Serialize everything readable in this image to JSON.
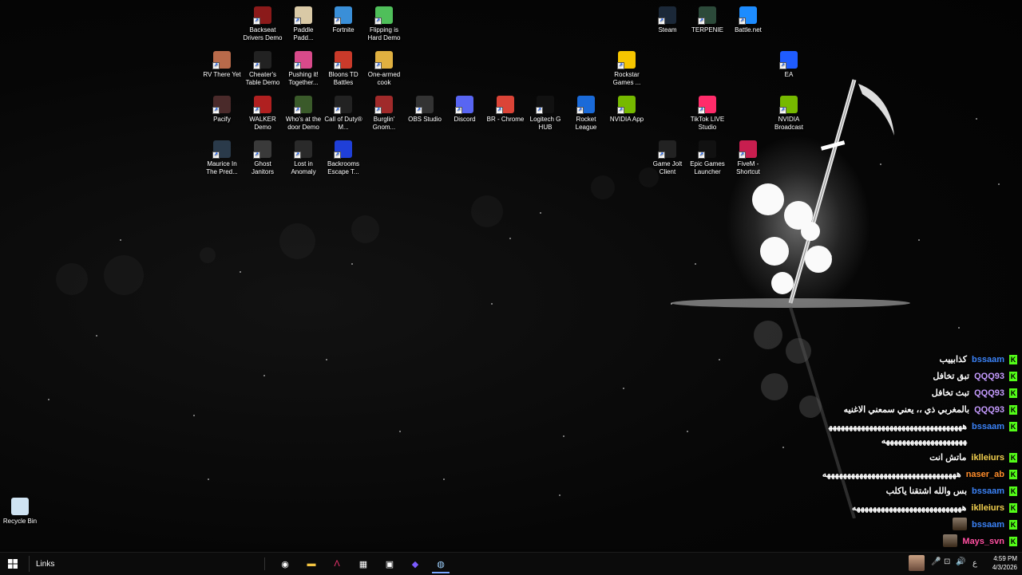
{
  "desktop": {
    "icons": [
      {
        "label": "Backseat Drivers Demo",
        "icon": "car-icon",
        "color": "#8b1a1a"
      },
      {
        "label": "Paddle Padd...",
        "icon": "face-icon",
        "color": "#d9c9a6"
      },
      {
        "label": "Fortnite",
        "icon": "fortnite-icon",
        "color": "#3a8fd8"
      },
      {
        "label": "Flipping is Hard Demo",
        "icon": "flip-icon",
        "color": "#4fbf5a"
      },
      {
        "label": "Steam",
        "icon": "steam-icon",
        "color": "#1b2838"
      },
      {
        "label": "TERPENIE",
        "icon": "terpenie-icon",
        "color": "#2c4a3a"
      },
      {
        "label": "Battle.net",
        "icon": "battlenet-icon",
        "color": "#1d8cff"
      },
      {
        "label": "RV There Yet",
        "icon": "rv-icon",
        "color": "#b86a4a"
      },
      {
        "label": "Cheater's Table Demo",
        "icon": "ct-icon",
        "color": "#222"
      },
      {
        "label": "Pushing it! Together...",
        "icon": "pushing-icon",
        "color": "#d84a8a"
      },
      {
        "label": "Bloons TD Battles",
        "icon": "bloons-icon",
        "color": "#c93a2a"
      },
      {
        "label": "One-armed cook",
        "icon": "cook-icon",
        "color": "#e0b040"
      },
      {
        "label": "Rockstar Games ...",
        "icon": "rockstar-icon",
        "color": "#f7c600"
      },
      {
        "label": "EA",
        "icon": "ea-icon",
        "color": "#1f5cff"
      },
      {
        "label": "Pacify",
        "icon": "pacify-icon",
        "color": "#4a2a2a"
      },
      {
        "label": "WALKER Demo",
        "icon": "walker-icon",
        "color": "#b02020"
      },
      {
        "label": "Who's at the door Demo",
        "icon": "door-icon",
        "color": "#3a5a2a"
      },
      {
        "label": "Call of Duty® M...",
        "icon": "cod-icon",
        "color": "#222"
      },
      {
        "label": "Burglin' Gnom...",
        "icon": "gnome-icon",
        "color": "#a02a2a"
      },
      {
        "label": "OBS Studio",
        "icon": "obs-icon",
        "color": "#333"
      },
      {
        "label": "Discord",
        "icon": "discord-icon",
        "color": "#5865f2"
      },
      {
        "label": "BR - Chrome",
        "icon": "chrome-icon",
        "color": "#db4437"
      },
      {
        "label": "Logitech G HUB",
        "icon": "logitech-icon",
        "color": "#111"
      },
      {
        "label": "Rocket League",
        "icon": "rocket-icon",
        "color": "#1a6ad8"
      },
      {
        "label": "NVIDIA App",
        "icon": "nvidia-icon",
        "color": "#76b900"
      },
      {
        "label": "TikTok LIVE Studio",
        "icon": "tiktok-icon",
        "color": "#ff2c6a"
      },
      {
        "label": "NVIDIA Broadcast",
        "icon": "nvidia-broadcast-icon",
        "color": "#76b900"
      },
      {
        "label": "Maurice In The Pred...",
        "icon": "maurice-icon",
        "color": "#2a3a4a"
      },
      {
        "label": "Ghost Janitors",
        "icon": "ghost-icon",
        "color": "#3a3a3a"
      },
      {
        "label": "Lost in Anomaly",
        "icon": "anomaly-icon",
        "color": "#2a2a2a"
      },
      {
        "label": "Backrooms Escape T...",
        "icon": "backrooms-icon",
        "color": "#1f3fd8"
      },
      {
        "label": "Game Jolt Client",
        "icon": "gamejolt-icon",
        "color": "#222"
      },
      {
        "label": "Epic Games Launcher",
        "icon": "epic-icon",
        "color": "#111"
      },
      {
        "label": "FiveM - Shortcut",
        "icon": "fivem-icon",
        "color": "#c81e4f"
      },
      {
        "label": "Recycle Bin",
        "icon": "recycle-bin-icon",
        "color": "#cfe3f2"
      }
    ]
  },
  "chat": {
    "messages": [
      {
        "user": "bssaam",
        "color": "#3b82f6",
        "text": "كذابييب"
      },
      {
        "user": "QQQ93",
        "color": "#c59bff",
        "text": "تبق تخافل"
      },
      {
        "user": "QQQ93",
        "color": "#c59bff",
        "text": "تبث تخافل"
      },
      {
        "user": "QQQ93",
        "color": "#c59bff",
        "text": "بالمغربي ذي ،، يعني سمعني الاغنيه"
      },
      {
        "user": "bssaam",
        "color": "#3b82f6",
        "text": "ههههههههههههههههههههههههههههههههههههههههههههههههههههههه"
      },
      {
        "user": "iklleiurs",
        "color": "#f2d04f",
        "text": "ماتش انت"
      },
      {
        "user": "naser_ab",
        "color": "#ff8c2a",
        "text": "هههههههههههههههههههههههههههههههههه"
      },
      {
        "user": "bssaam",
        "color": "#3b82f6",
        "text": "بس والله اشتقنا ياكلب"
      },
      {
        "user": "iklleiurs",
        "color": "#f2d04f",
        "text": "هههههههههههههههههههههههههههه"
      },
      {
        "user": "bssaam",
        "color": "#3b82f6",
        "text": ""
      },
      {
        "user": "Mays_svn",
        "color": "#ff4fa0",
        "text": ""
      }
    ],
    "platform_badge": "K"
  },
  "taskbar": {
    "links_label": "Links",
    "time": "4:59 PM",
    "date": "4/3/2026",
    "lang": "ع",
    "apps": [
      {
        "icon": "obs-taskbar-icon"
      },
      {
        "icon": "file-explorer-icon"
      },
      {
        "icon": "fivem-taskbar-icon"
      },
      {
        "icon": "store-icon"
      },
      {
        "icon": "app-icon"
      },
      {
        "icon": "diamond-app-icon"
      },
      {
        "icon": "steam-taskbar-icon"
      }
    ]
  }
}
